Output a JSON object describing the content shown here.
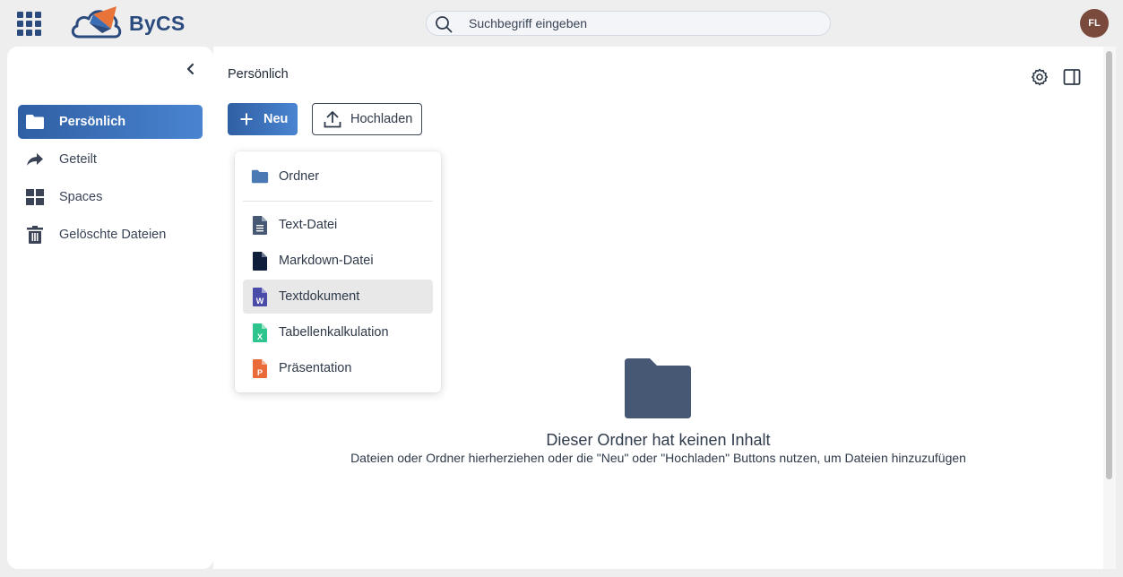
{
  "colors": {
    "brand": "#2b4a7e",
    "accent_start": "#2f5fa3",
    "accent_end": "#4a84d1",
    "avatar_bg": "#7a4a3c",
    "folder_icon": "#4a79b4",
    "empty_folder": "#475875",
    "word_icon": "#4a4aa8",
    "excel_icon": "#2dc48d",
    "powerpoint_icon": "#ea6a3a"
  },
  "header": {
    "logo_text": "ByCS",
    "search_placeholder": "Suchbegriff eingeben",
    "search_value": "",
    "avatar_initials": "FL",
    "icons": {
      "apps": "grid-icon",
      "search": "search-icon"
    }
  },
  "sidebar": {
    "items": [
      {
        "label": "Persönlich",
        "icon": "folder-icon",
        "active": true
      },
      {
        "label": "Geteilt",
        "icon": "share-icon",
        "active": false
      },
      {
        "label": "Spaces",
        "icon": "spaces-grid-icon",
        "active": false
      },
      {
        "label": "Gelöschte Dateien",
        "icon": "trash-icon",
        "active": false
      }
    ]
  },
  "main": {
    "breadcrumb": "Persönlich",
    "new_button": "Neu",
    "upload_button": "Hochladen",
    "menu": {
      "items": [
        {
          "label": "Ordner",
          "icon": "folder-icon"
        },
        {
          "label": "Text-Datei",
          "icon": "text-file-icon"
        },
        {
          "label": "Markdown-Datei",
          "icon": "markdown-file-icon"
        },
        {
          "label": "Textdokument",
          "icon": "word-document-icon",
          "hover": true
        },
        {
          "label": "Tabellenkalkulation",
          "icon": "spreadsheet-icon"
        },
        {
          "label": "Präsentation",
          "icon": "presentation-icon"
        }
      ]
    },
    "empty_state": {
      "title": "Dieser Ordner hat keinen Inhalt",
      "subtitle": "Dateien oder Ordner hierherziehen oder die \"Neu\" oder \"Hochladen\" Buttons nutzen, um Dateien hinzuzufügen"
    }
  }
}
